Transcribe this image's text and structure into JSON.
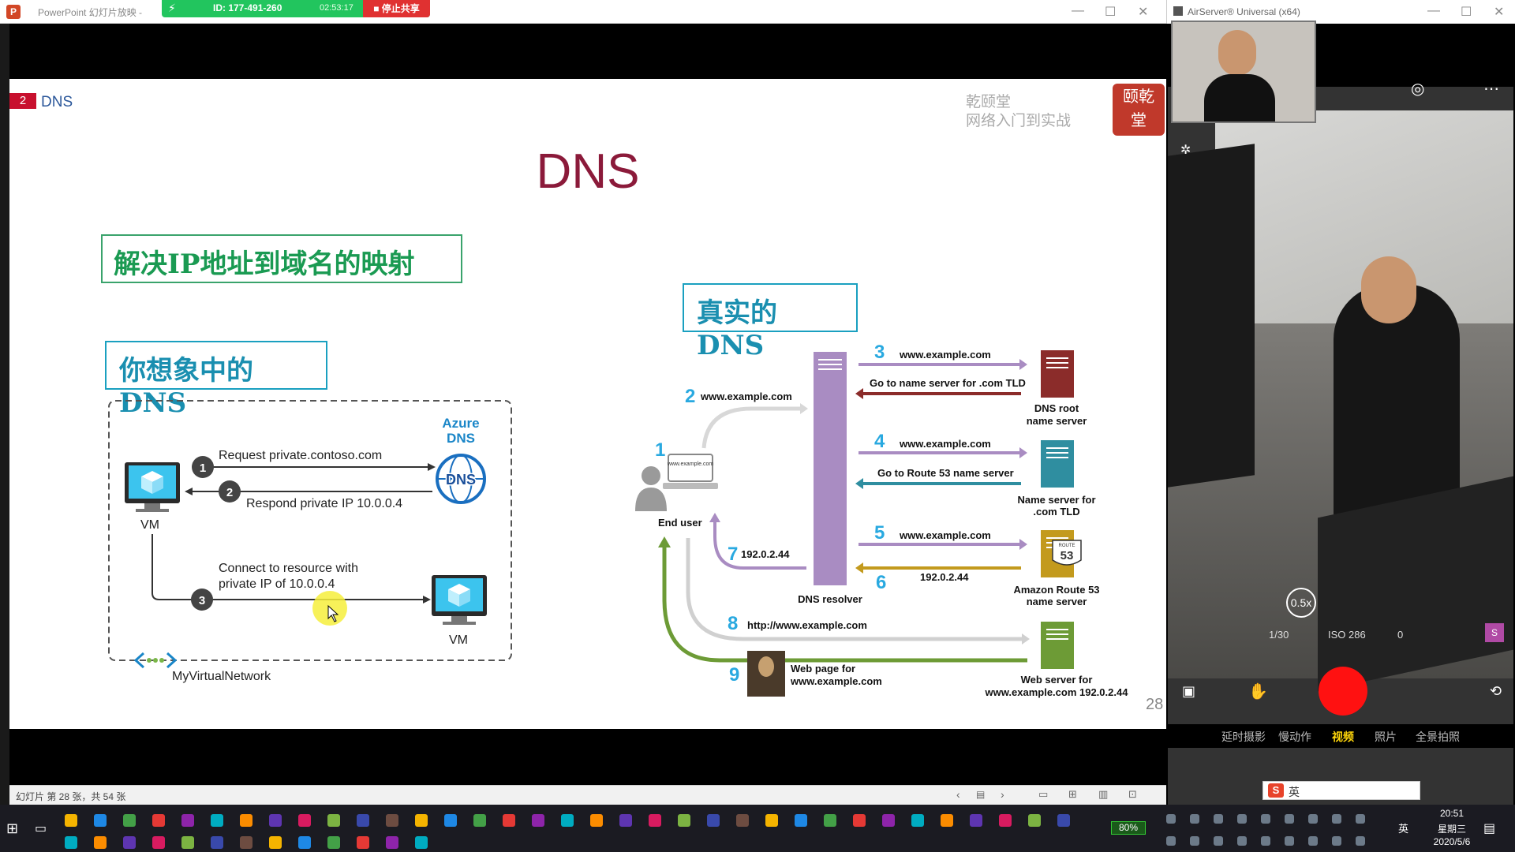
{
  "ppt_window": {
    "title": "PowerPoint 幻灯片放映 - ",
    "share": {
      "id_label": "ID: 177-491-260",
      "elapsed": "02:53:17",
      "stop_label": "停止共享"
    },
    "controls": {
      "minimize": "—",
      "maximize": "☐",
      "close": "✕"
    },
    "status_text": "幻灯片 第 28 张，共 54 张"
  },
  "slide": {
    "section_number": "2",
    "section_title": "DNS",
    "brand_line1": "乾颐堂",
    "brand_line2": "网络入门到实战",
    "seal_text": "颐乾\n堂",
    "title": "DNS",
    "box_mapping": "解决IP地址到域名的映射",
    "box_imagined": "你想象中的DNS",
    "box_real": "真实的DNS",
    "page_number": "28"
  },
  "azure_diagram": {
    "azure_label_1": "Azure",
    "azure_label_2": "DNS",
    "dns_circle": "DNS",
    "step1_num": "1",
    "step1_text": "Request private.contoso.com",
    "step2_num": "2",
    "step2_text": "Respond private IP 10.0.0.4",
    "step3_num": "3",
    "step3_text_1": "Connect to resource with",
    "step3_text_2": "private IP of 10.0.0.4",
    "vm_left": "VM",
    "vm_right": "VM",
    "network_label": "MyVirtualNetwork"
  },
  "route53_diagram": {
    "n1": "1",
    "end_user": "End user",
    "laptop_text": "www.example.com",
    "n2": "2",
    "q2": "www.example.com",
    "n3": "3",
    "q3": "www.example.com",
    "r3": "Go to name server for .com TLD",
    "root_1": "DNS root",
    "root_2": "name server",
    "n4": "4",
    "q4": "www.example.com",
    "r4": "Go to Route 53 name server",
    "tld_1": "Name server for",
    "tld_2": ".com TLD",
    "n5": "5",
    "q5": "www.example.com",
    "n6": "6",
    "r6": "192.0.2.44",
    "route53_1": "Amazon Route 53",
    "route53_2": "name server",
    "route53_badge_top": "ROUTE",
    "route53_badge": "53",
    "n7": "7",
    "r7": "192.0.2.44",
    "resolver": "DNS resolver",
    "n8": "8",
    "q8": "http://www.example.com",
    "n9": "9",
    "page_1": "Web page for",
    "page_2": "www.example.com",
    "web_1": "Web server for",
    "web_2": "www.example.com 192.0.2.44"
  },
  "airserver": {
    "title": "AirServer® Universal (x64)",
    "zoom": "0.5x",
    "shutter": "1/30",
    "iso": "ISO 286",
    "ev": "0",
    "badge": "S",
    "modes": [
      "延时摄影",
      "慢动作",
      "视频",
      "照片",
      "全景拍照"
    ],
    "active_mode": "视频",
    "ime": "英"
  },
  "taskbar": {
    "battery": "80%",
    "ime_lang": "英",
    "time": "20:51",
    "weekday": "星期三",
    "date": "2020/5/6"
  },
  "colors": {
    "accent_red": "#c8102e",
    "title_red": "#8b1a3a",
    "box_green": "#3aa36c",
    "box_blue": "#1aa0c0",
    "resolver_purple": "#a98cc2",
    "root_red": "#8b2c2a",
    "tld_teal": "#2f8ea0",
    "route53_gold": "#c39a1d",
    "web_green": "#6d9b36"
  }
}
